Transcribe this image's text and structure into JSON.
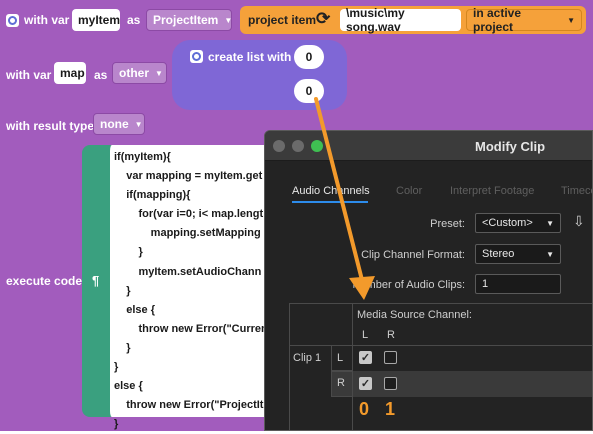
{
  "block": {
    "row1": {
      "with_var": "with var",
      "var_name": "myItem",
      "as": "as",
      "type": "ProjectItem",
      "project_item": "project item",
      "path": "\\music\\my song.wav",
      "scope": "in active project"
    },
    "row2": {
      "with_var": "with var",
      "var_name": "map",
      "as": "as",
      "type": "other",
      "create_list": "create list with",
      "item1": "0",
      "item2": "0"
    },
    "row3": {
      "label": "with result type",
      "value": "none"
    },
    "execute": {
      "label": "execute code",
      "pilcrow": "¶",
      "lines": [
        "if(myItem){",
        "    var mapping = myItem.get",
        "    if(mapping){",
        "        for(var i=0; i< map.lengt",
        "            mapping.setMapping",
        "        }",
        "        myItem.setAudioChann",
        "    }",
        "    else {",
        "        throw new Error(\"Curren",
        "    }",
        "}",
        "else {",
        "    throw new Error(\"ProjectIt",
        "}"
      ]
    }
  },
  "dialog": {
    "title": "Modify Clip",
    "tabs": [
      "Audio Channels",
      "Color",
      "Interpret Footage",
      "Timeco"
    ],
    "preset_label": "Preset:",
    "preset_value": "<Custom>",
    "format_label": "Clip Channel Format:",
    "format_value": "Stereo",
    "num_label": "Number of Audio Clips:",
    "num_value": "1",
    "source_label": "Media Source Channel:",
    "col_l": "L",
    "col_r": "R",
    "clip_label": "Clip 1",
    "row_l": "L",
    "row_r": "R",
    "index0": "0",
    "index1": "1"
  },
  "colors": {
    "block_purple": "#a25cbd",
    "list_block": "#7f67d6",
    "code_green": "#3aa07f",
    "project_orange": "#f5a13a",
    "annotation_arrow": "#f39a2b",
    "dialog_bg": "#232323",
    "tab_accent": "#2d8ceb"
  }
}
